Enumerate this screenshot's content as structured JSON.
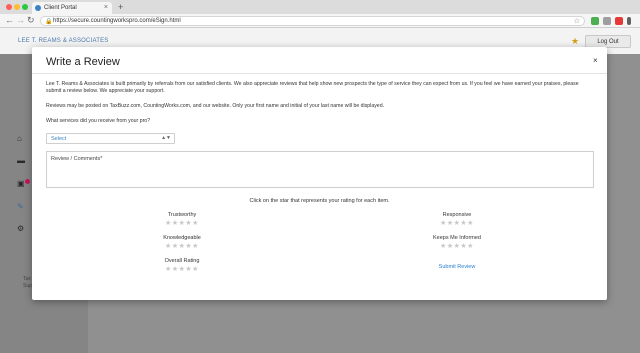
{
  "browser": {
    "tab_title": "Client Portal",
    "new_tab": "+",
    "tab_close": "×",
    "url": "https://secure.countingworkspro.com/eSign.html",
    "lock_glyph": "🔒",
    "back": "←",
    "forward": "→",
    "reload": "↻",
    "bookmark_glyph": "☆"
  },
  "app": {
    "brand": "LEE T. REAMS & ASSOCIATES",
    "favorite_glyph": "★",
    "logout_label": "Log Out"
  },
  "sidebar": {
    "icons": [
      "home-icon",
      "chat-icon",
      "documents-icon",
      "edit-icon",
      "settings-icon"
    ],
    "glyphs": [
      "⌂",
      "▬",
      "▣",
      "✎",
      "⚙"
    ],
    "small_text": [
      "Tax",
      "Supp"
    ]
  },
  "modal": {
    "title": "Write a Review",
    "close_glyph": "×",
    "intro": "Lee T. Reams & Associates is built primarily by referrals from our satisfied clients. We also appreciate reviews that help show new prospects the type of service they can expect from us. If you feel we have earned your praises, please submit a review below. We appreciate your support.",
    "posting_note": "Reviews may be posted on TaxBuzz.com, CountingWorks.com, and our website. Only your first name and initial of your last name will be displayed.",
    "services_question": "What services did you receive from your pro?",
    "select_value": "Select",
    "select_caret": "▲▼",
    "comments_placeholder": "Review / Comments*",
    "rating_instruction": "Click on the star that represents your rating for each item.",
    "ratings": [
      {
        "label": "Trustworthy",
        "stars": "★★★★★"
      },
      {
        "label": "Responsive",
        "stars": "★★★★★"
      },
      {
        "label": "Knowledgeable",
        "stars": "★★★★★"
      },
      {
        "label": "Keeps Me Informed",
        "stars": "★★★★★"
      },
      {
        "label": "Overall Rating",
        "stars": "★★★★★"
      }
    ],
    "submit_label": "Submit Review"
  },
  "colors": {
    "link": "#2a7fd4",
    "brand": "#4a78a8",
    "star_empty": "#c8c8c8",
    "favorite_star": "#d4a017"
  }
}
